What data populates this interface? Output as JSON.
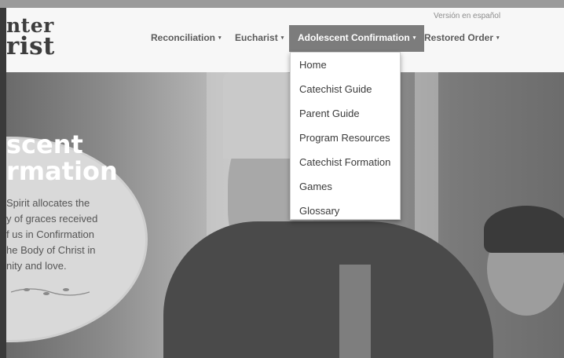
{
  "logo": {
    "line1": "nter",
    "line2": "rist"
  },
  "language_link": "Versión en español",
  "nav": {
    "items": [
      {
        "label": "Reconciliation",
        "caret": "▾"
      },
      {
        "label": "Eucharist",
        "caret": "▾"
      },
      {
        "label": "Adolescent Confirmation",
        "caret": "▾",
        "active": true
      },
      {
        "label": "Restored Order",
        "caret": "▾"
      }
    ]
  },
  "dropdown": {
    "items": [
      "Home",
      "Catechist Guide",
      "Parent Guide",
      "Program Resources",
      "Catechist Formation",
      "Games",
      "Glossary"
    ]
  },
  "hero": {
    "title_line1": "scent",
    "title_line2": "rmation",
    "text_lines": [
      "Spirit allocates the",
      "y of graces received",
      "f us in Confirmation",
      "he Body of Christ in",
      "nity and love."
    ]
  },
  "colors": {
    "active_nav_bg": "#7c7c7c",
    "header_bg": "#f7f7f7"
  }
}
